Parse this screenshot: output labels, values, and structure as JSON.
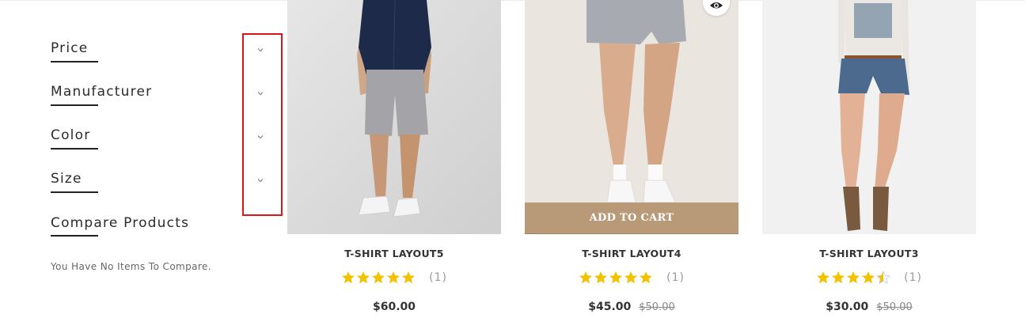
{
  "sidebar": {
    "filters": [
      {
        "label": "Price"
      },
      {
        "label": "Manufacturer"
      },
      {
        "label": "Color"
      },
      {
        "label": "Size"
      }
    ],
    "compare": {
      "title": "Compare Products",
      "empty_text": "You Have No Items To Compare."
    }
  },
  "products": [
    {
      "name": "T-SHIRT LAYOUT5",
      "price": "$60.00",
      "old_price": "",
      "rating": 5,
      "rating_count": "(1)"
    },
    {
      "name": "T-SHIRT LAYOUT4",
      "price": "$45.00",
      "old_price": "$50.00",
      "rating": 5,
      "rating_count": "(1)",
      "add_to_cart": "ADD TO CART",
      "quick_view_icon": "eye-icon"
    },
    {
      "name": "T-SHIRT LAYOUT3",
      "price": "$30.00",
      "old_price": "$50.00",
      "rating": 4.5,
      "rating_count": "(1)"
    }
  ],
  "colors": {
    "accent": "#b89a78",
    "star": "#f2c200",
    "highlight": "#d9141b"
  }
}
